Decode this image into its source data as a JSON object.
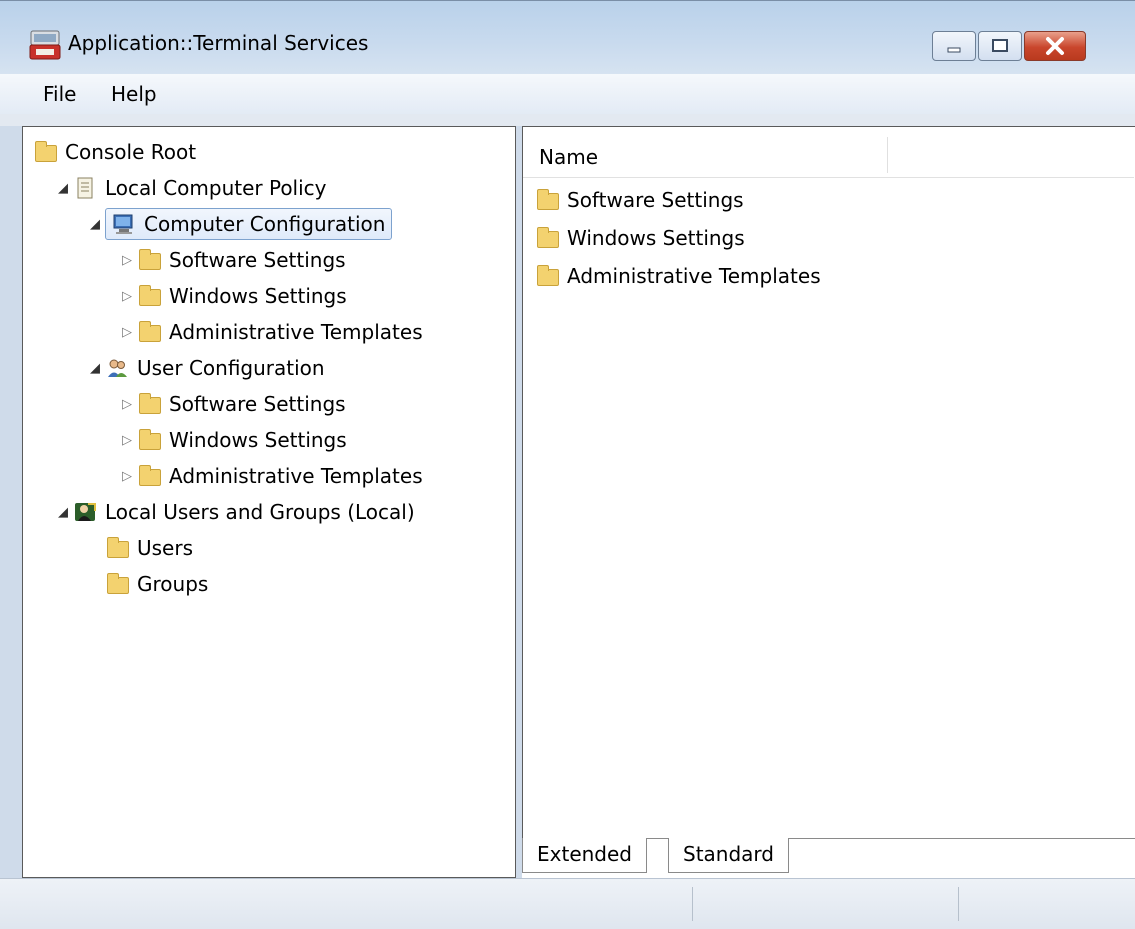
{
  "window": {
    "title": "Application::Terminal Services"
  },
  "menu": {
    "file": "File",
    "help": "Help"
  },
  "tree": {
    "root": "Console Root",
    "local_computer_policy": "Local Computer Policy",
    "computer_configuration": "Computer Configuration",
    "cc_software_settings": "Software Settings",
    "cc_windows_settings": "Windows Settings",
    "cc_admin_templates": "Administrative Templates",
    "user_configuration": "User Configuration",
    "uc_software_settings": "Software Settings",
    "uc_windows_settings": "Windows Settings",
    "uc_admin_templates": "Administrative Templates",
    "local_users_groups": "Local Users and Groups (Local)",
    "users": "Users",
    "groups": "Groups"
  },
  "list": {
    "header_name": "Name",
    "items": [
      "Software Settings",
      "Windows Settings",
      "Administrative Templates"
    ]
  },
  "tabs": {
    "extended": "Extended",
    "standard": "Standard",
    "active": "Standard"
  },
  "colors": {
    "titlebar": "#c8daee",
    "selection_border": "#7da2ce",
    "folder": "#f3d26f",
    "close_button": "#c9462c"
  }
}
